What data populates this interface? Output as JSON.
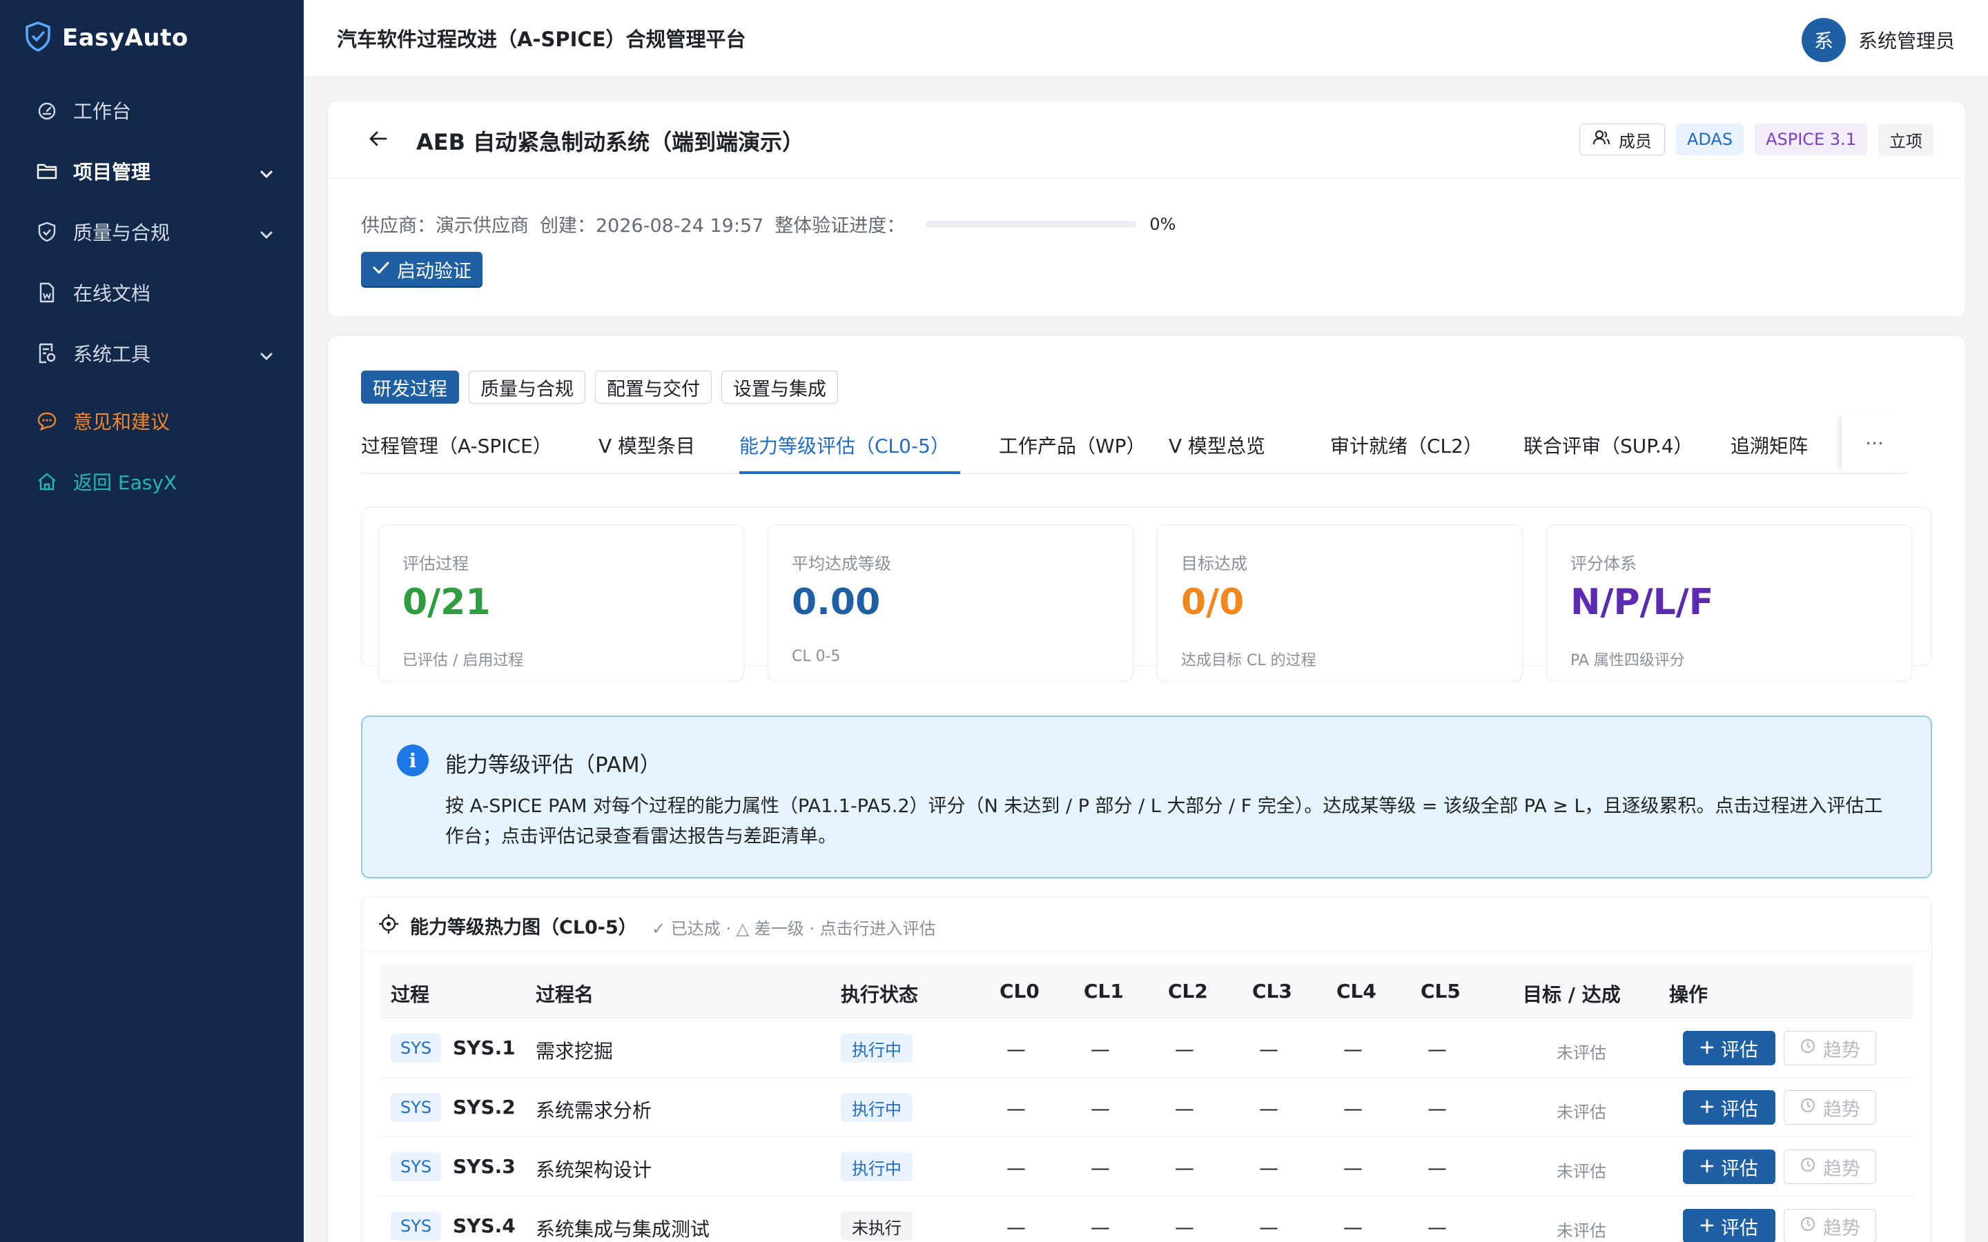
{
  "brand": {
    "name": "EasyAuto"
  },
  "sidebar": {
    "items": [
      {
        "label": "工作台",
        "icon": "dashboard-icon"
      },
      {
        "label": "项目管理",
        "icon": "folder-icon"
      },
      {
        "label": "质量与合规",
        "icon": "shield-icon"
      },
      {
        "label": "在线文档",
        "icon": "document-icon"
      },
      {
        "label": "系统工具",
        "icon": "tools-icon"
      },
      {
        "label": "意见和建议",
        "icon": "chat-icon"
      },
      {
        "label": "返回 EasyX",
        "icon": "home-icon"
      }
    ]
  },
  "header": {
    "title": "汽车软件过程改进（A-SPICE）合规管理平台",
    "avatar_text": "系",
    "user_name": "系统管理员"
  },
  "project": {
    "title": "AEB 自动紧急制动系统（端到端演示）",
    "member_label": "成员",
    "tags": [
      "ADAS",
      "ASPICE 3.1",
      "立项"
    ],
    "meta": {
      "supplier": "供应商：演示供应商",
      "created": "创建：2026-08-24 19:57",
      "progress_label": "整体验证进度：",
      "progress_percent": 0,
      "progress_text": "0%"
    },
    "start_label": "启动验证"
  },
  "segments": [
    "研发过程",
    "质量与合规",
    "配置与交付",
    "设置与集成"
  ],
  "tabs": [
    "过程管理（A-SPICE）",
    "V 模型条目",
    "能力等级评估（CL0-5）",
    "工作产品（WP）",
    "V 模型总览",
    "审计就绪（CL2）",
    "联合评审（SUP.4）",
    "追溯矩阵"
  ],
  "tab_more": "···",
  "stats": [
    {
      "label": "评估过程",
      "value": "0/21",
      "sub": "已评估 / 启用过程",
      "color": "#2e9d3f"
    },
    {
      "label": "平均达成等级",
      "value": "0.00",
      "sub": "CL 0-5",
      "color": "#1f5fa3"
    },
    {
      "label": "目标达成",
      "value": "0/0",
      "sub": "达成目标 CL 的过程",
      "color": "#f0881e"
    },
    {
      "label": "评分体系",
      "value": "N/P/L/F",
      "sub": "PA 属性四级评分",
      "color": "#5b2ab0"
    }
  ],
  "info": {
    "icon_text": "i",
    "title": "能力等级评估（PAM）",
    "body": "按 A-SPICE PAM 对每个过程的能力属性（PA1.1-PA5.2）评分（N 未达到 / P 部分 / L 大部分 / F 完全）。达成某等级 = 该级全部 PA ≥ L，且逐级累积。点击过程进入评估工作台；点击评估记录查看雷达报告与差距清单。"
  },
  "heatmap": {
    "title": "能力等级热力图（CL0-5）",
    "legend": "✓ 已达成 · △ 差一级 · 点击行进入评估",
    "columns": [
      "过程",
      "过程名",
      "执行状态",
      "CL0",
      "CL1",
      "CL2",
      "CL3",
      "CL4",
      "CL5",
      "目标 / 达成",
      "操作"
    ],
    "rows": [
      {
        "tag": "SYS",
        "id": "SYS.1",
        "name": "需求挖掘",
        "state": "执行中",
        "running": true,
        "cl": [
          "—",
          "—",
          "—",
          "—",
          "—",
          "—"
        ],
        "target": "未评估"
      },
      {
        "tag": "SYS",
        "id": "SYS.2",
        "name": "系统需求分析",
        "state": "执行中",
        "running": true,
        "cl": [
          "—",
          "—",
          "—",
          "—",
          "—",
          "—"
        ],
        "target": "未评估"
      },
      {
        "tag": "SYS",
        "id": "SYS.3",
        "name": "系统架构设计",
        "state": "执行中",
        "running": true,
        "cl": [
          "—",
          "—",
          "—",
          "—",
          "—",
          "—"
        ],
        "target": "未评估"
      },
      {
        "tag": "SYS",
        "id": "SYS.4",
        "name": "系统集成与集成测试",
        "state": "未执行",
        "running": false,
        "cl": [
          "—",
          "—",
          "—",
          "—",
          "—",
          "—"
        ],
        "target": "未评估"
      }
    ],
    "eval_label": "评估",
    "trend_label": "趋势"
  }
}
